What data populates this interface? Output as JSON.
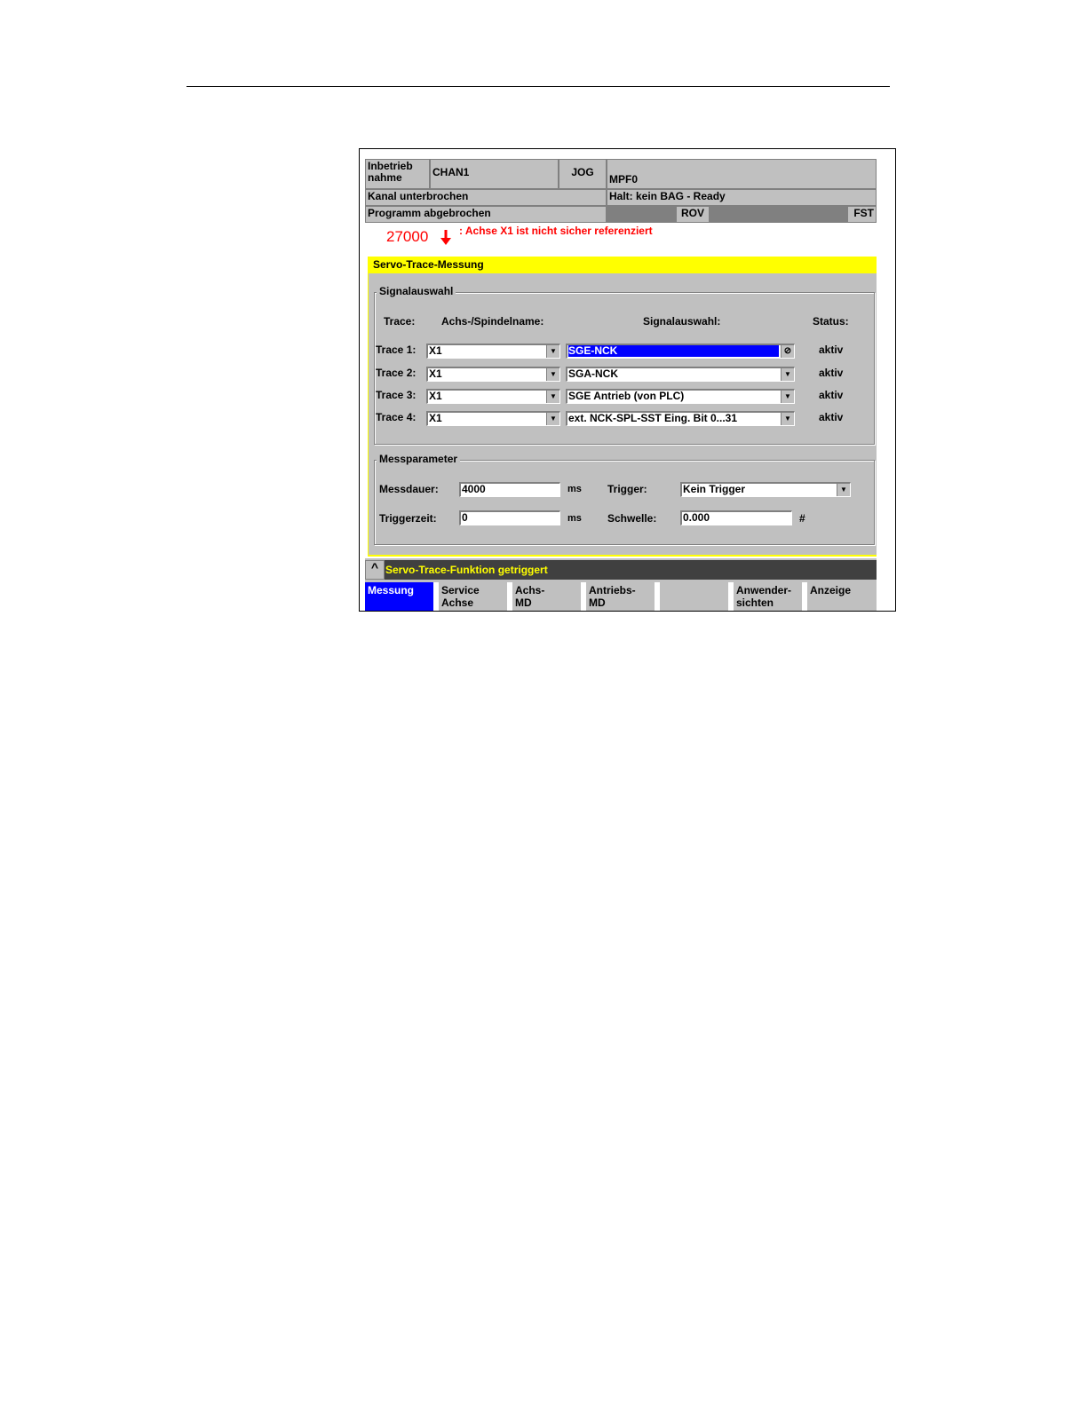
{
  "header": {
    "area_line1": "Inbetrieb",
    "area_line2": "nahme",
    "channel": "CHAN1",
    "mode": "JOG",
    "program": "MPF0",
    "channel_status": "Kanal unterbrochen",
    "halt_status": "Halt: kein BAG - Ready",
    "program_status": "Programm abgebrochen",
    "rov": "ROV",
    "fst": "FST"
  },
  "alarm": {
    "number": "27000",
    "text": ": Achse X1 ist nicht sicher referenziert",
    "color": "#ff0000"
  },
  "title_bar": {
    "title": "Servo-Trace-Messung",
    "color": "#ffff00"
  },
  "signal_group": {
    "legend": "Signalauswahl",
    "headers": {
      "trace": "Trace:",
      "axis": "Achs-/Spindelname:",
      "signal": "Signalauswahl:",
      "status": "Status:"
    },
    "rows": [
      {
        "label": "Trace 1:",
        "axis": "X1",
        "signal": "SGE-NCK",
        "status": "aktiv"
      },
      {
        "label": "Trace 2:",
        "axis": "X1",
        "signal": "SGA-NCK",
        "status": "aktiv"
      },
      {
        "label": "Trace 3:",
        "axis": "X1",
        "signal": "SGE Antrieb (von PLC)",
        "status": "aktiv"
      },
      {
        "label": "Trace 4:",
        "axis": "X1",
        "signal": "ext. NCK-SPL-SST Eing.  Bit 0...31",
        "status": "aktiv"
      }
    ]
  },
  "mess_group": {
    "legend": "Messparameter",
    "messdauer_label": "Messdauer:",
    "messdauer_value": "4000",
    "messdauer_unit": "ms",
    "trigger_label": "Trigger:",
    "trigger_value": "Kein Trigger",
    "triggerzeit_label": "Triggerzeit:",
    "triggerzeit_value": "0",
    "triggerzeit_unit": "ms",
    "schwelle_label": "Schwelle:",
    "schwelle_value": "0.000",
    "schwelle_unit": "#"
  },
  "status_bar": {
    "caret": "^",
    "message": "Servo-Trace-Funktion getriggert"
  },
  "softkeys": [
    {
      "l1": "Messung",
      "l2": ""
    },
    {
      "l1": "Service",
      "l2": "Achse"
    },
    {
      "l1": "Achs-",
      "l2": "MD"
    },
    {
      "l1": "Antriebs-",
      "l2": "MD"
    },
    {
      "l1": "",
      "l2": ""
    },
    {
      "l1": "Anwender-",
      "l2": "sichten"
    },
    {
      "l1": "Anzeige",
      "l2": ""
    }
  ]
}
